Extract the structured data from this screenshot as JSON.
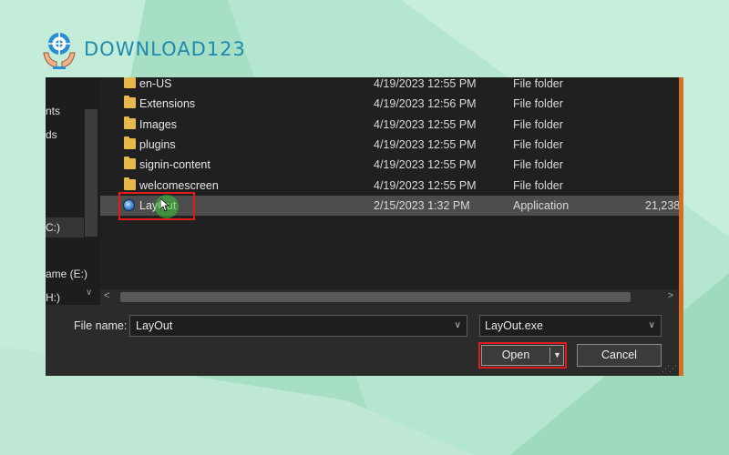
{
  "brand": {
    "name": "DOWNLOAD123",
    "logo_icon": "globe-hands-icon",
    "text_color": "#1f8ab0"
  },
  "colors": {
    "background": "#b5e6cf",
    "dialog": "#202020",
    "highlight": "#e01b1b",
    "folder": "#e7b84b"
  },
  "nav_pane": {
    "items": [
      {
        "label": "nts"
      },
      {
        "label": "ds"
      },
      {
        "label": "C:)"
      },
      {
        "label": "ame (E:)"
      },
      {
        "label": "H:)"
      }
    ]
  },
  "files": [
    {
      "name": "en-US",
      "date": "4/19/2023 12:55 PM",
      "type": "File folder",
      "size": "",
      "icon": "folder-icon"
    },
    {
      "name": "Extensions",
      "date": "4/19/2023 12:56 PM",
      "type": "File folder",
      "size": "",
      "icon": "folder-icon"
    },
    {
      "name": "Images",
      "date": "4/19/2023 12:55 PM",
      "type": "File folder",
      "size": "",
      "icon": "folder-icon"
    },
    {
      "name": "plugins",
      "date": "4/19/2023 12:55 PM",
      "type": "File folder",
      "size": "",
      "icon": "folder-icon"
    },
    {
      "name": "signin-content",
      "date": "4/19/2023 12:55 PM",
      "type": "File folder",
      "size": "",
      "icon": "folder-icon"
    },
    {
      "name": "welcomescreen",
      "date": "4/19/2023 12:55 PM",
      "type": "File folder",
      "size": "",
      "icon": "folder-icon"
    },
    {
      "name": "LayOut",
      "date": "2/15/2023 1:32 PM",
      "type": "Application",
      "size": "21,238",
      "icon": "app-icon"
    }
  ],
  "bottom": {
    "file_name_label": "File name:",
    "file_name_value": "LayOut",
    "file_type_value": "LayOut.exe",
    "open_label": "Open",
    "cancel_label": "Cancel"
  }
}
